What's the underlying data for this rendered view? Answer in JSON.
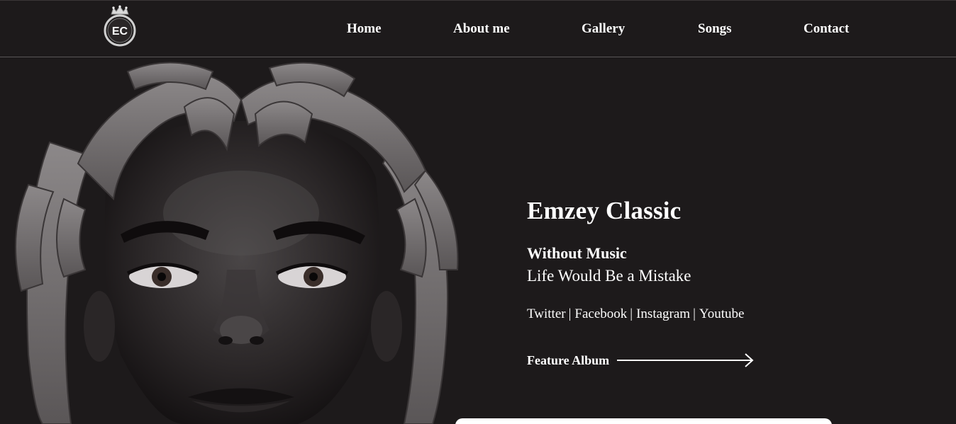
{
  "brand": {
    "logo_text": "EC"
  },
  "nav": {
    "items": [
      {
        "label": "Home"
      },
      {
        "label": "About me"
      },
      {
        "label": "Gallery"
      },
      {
        "label": "Songs"
      },
      {
        "label": "Contact"
      }
    ]
  },
  "hero": {
    "artist_name": "Emzey Classic",
    "tagline_line1": "Without Music",
    "tagline_line2": "Life Would Be a Mistake",
    "socials": [
      {
        "label": "Twitter"
      },
      {
        "label": "Facebook"
      },
      {
        "label": "Instagram"
      },
      {
        "label": "Youtube"
      }
    ],
    "separator": "|",
    "feature_label": "Feature Album",
    "feature_icon": "arrow-right-icon",
    "portrait_icon": "artist-portrait"
  },
  "colors": {
    "background": "#1d1a1b",
    "text": "#ffffff",
    "nav_border": "#5a5657"
  }
}
